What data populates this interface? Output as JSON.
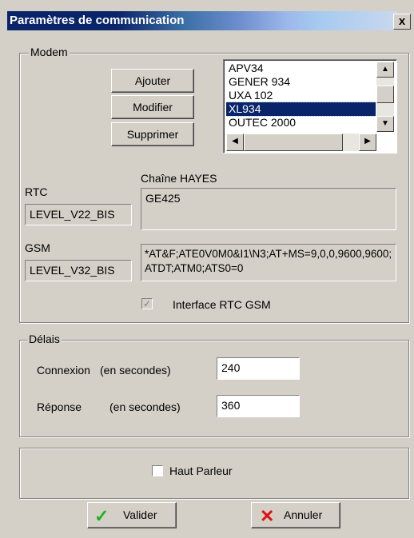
{
  "window": {
    "title": "Paramètres de communication",
    "close_label": "x"
  },
  "modem": {
    "legend": "Modem",
    "buttons": {
      "add": "Ajouter",
      "modify": "Modifier",
      "delete": "Supprimer"
    },
    "list": {
      "items": [
        "APV34",
        "GENER 934",
        "UXA 102",
        "XL934",
        "OUTEC 2000"
      ],
      "selected_index": 3
    },
    "hayes_label": "Chaîne HAYES",
    "rtc": {
      "label": "RTC",
      "value": "LEVEL_V22_BIS",
      "hayes": "GE425"
    },
    "gsm": {
      "label": "GSM",
      "value": "LEVEL_V32_BIS",
      "hayes": "*AT&F;ATE0V0M0&I1\\N3;AT+MS=9,0,0,9600,9600;ATDT;ATM0;ATS0=0"
    },
    "interface_checkbox": {
      "label": "Interface RTC GSM",
      "checked": true,
      "enabled": false
    }
  },
  "delais": {
    "legend": "Délais",
    "connexion": {
      "label": "Connexion",
      "unit": "(en secondes)",
      "value": "240"
    },
    "reponse": {
      "label": "Réponse",
      "unit": "(en secondes)",
      "value": "360"
    }
  },
  "speaker": {
    "label": "Haut Parleur",
    "checked": false
  },
  "footer": {
    "validate": "Valider",
    "cancel": "Annuler"
  },
  "colors": {
    "title_bar": "#0a246a",
    "selection": "#0a246a",
    "validate_icon": "#20b020",
    "cancel_icon": "#e01010"
  }
}
